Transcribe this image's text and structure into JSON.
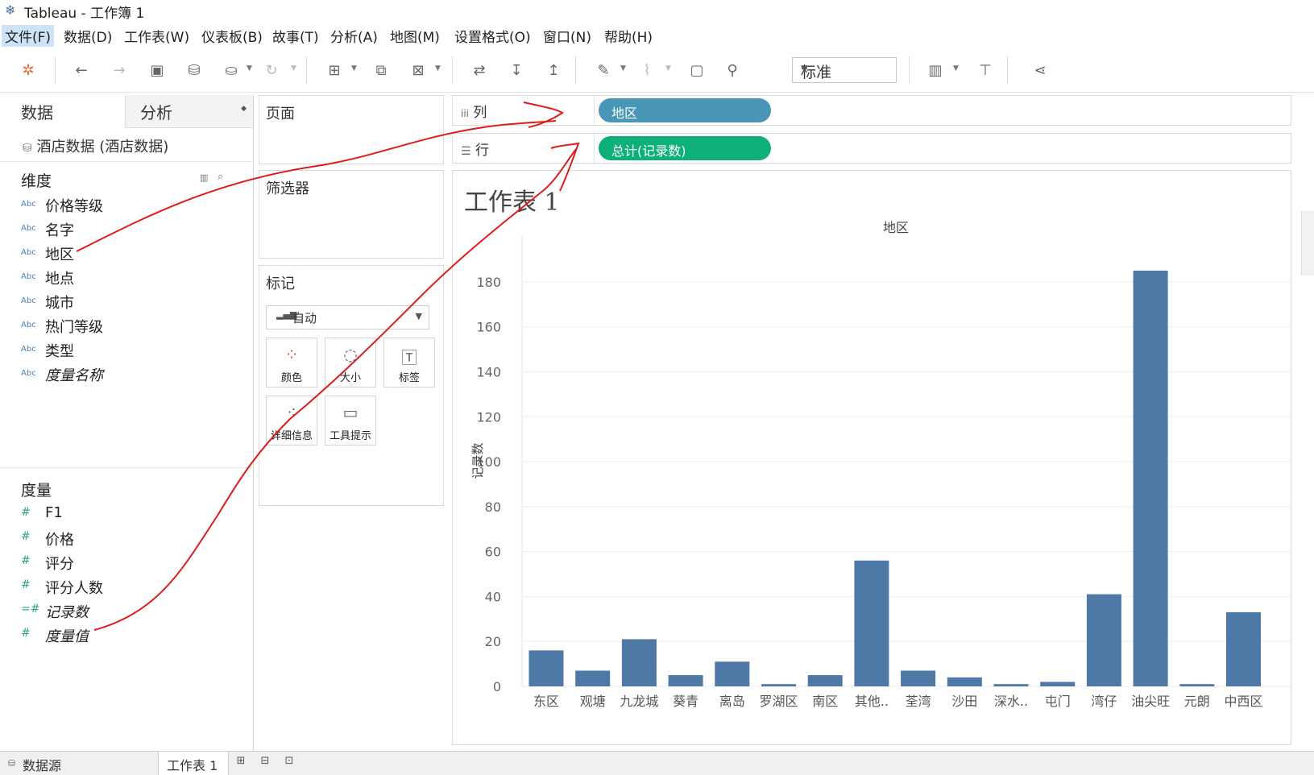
{
  "window": {
    "app_title": "Tableau - 工作簿 1"
  },
  "menu": [
    {
      "label": "文件(F)"
    },
    {
      "label": "数据(D)"
    },
    {
      "label": "工作表(W)"
    },
    {
      "label": "仪表板(B)"
    },
    {
      "label": "故事(T)"
    },
    {
      "label": "分析(A)"
    },
    {
      "label": "地图(M)"
    },
    {
      "label": "设置格式(O)"
    },
    {
      "label": "窗口(N)"
    },
    {
      "label": "帮助(H)"
    }
  ],
  "toolbar": {
    "fit_select": "标准"
  },
  "data_pane": {
    "tab_data": "数据",
    "tab_analysis": "分析",
    "datasource": "酒店数据 (酒店数据)",
    "dimensions_header": "维度",
    "dimensions": [
      {
        "icon": "Abc",
        "label": "价格等级"
      },
      {
        "icon": "Abc",
        "label": "名字"
      },
      {
        "icon": "Abc",
        "label": "地区"
      },
      {
        "icon": "Abc",
        "label": "地点"
      },
      {
        "icon": "Abc",
        "label": "城市"
      },
      {
        "icon": "Abc",
        "label": "热门等级"
      },
      {
        "icon": "Abc",
        "label": "类型"
      },
      {
        "icon": "Abc",
        "label": "度量名称"
      }
    ],
    "measures_header": "度量",
    "measures": [
      {
        "icon": "#",
        "label": "F1"
      },
      {
        "icon": "#",
        "label": "价格"
      },
      {
        "icon": "#",
        "label": "评分"
      },
      {
        "icon": "#",
        "label": "评分人数"
      },
      {
        "icon": "=#",
        "label": "记录数"
      },
      {
        "icon": "#",
        "label": "度量值"
      }
    ]
  },
  "cards": {
    "pages": "页面",
    "filters": "筛选器",
    "marks": "标记",
    "marks_type": "自动",
    "buttons": [
      {
        "label": "颜色"
      },
      {
        "label": "大小"
      },
      {
        "label": "标签"
      },
      {
        "label": "详细信息"
      },
      {
        "label": "工具提示"
      }
    ]
  },
  "shelves": {
    "columns_label": "列",
    "rows_label": "行",
    "columns_pill": "地区",
    "rows_pill": "总计(记录数)",
    "columns_color": "#4a96b7",
    "rows_color": "#0eb07a"
  },
  "sheet": {
    "title": "工作表 1"
  },
  "chart_data": {
    "type": "bar",
    "header": "地区",
    "ylabel": "记录数",
    "ylim": [
      0,
      190
    ],
    "yticks": [
      0,
      20,
      40,
      60,
      80,
      100,
      120,
      140,
      160,
      180
    ],
    "categories": [
      "东区",
      "观塘",
      "九龙城",
      "葵青",
      "离岛",
      "罗湖区",
      "南区",
      "其他..",
      "荃湾",
      "沙田",
      "深水..",
      "屯门",
      "湾仔",
      "油尖旺",
      "元朗",
      "中西区"
    ],
    "values": [
      16,
      7,
      21,
      5,
      11,
      1,
      5,
      56,
      7,
      4,
      1,
      2,
      41,
      185,
      1,
      33
    ],
    "bar_color": "#4e79a7",
    "grid": true
  },
  "bottom_bar": {
    "datasource_tab": "数据源",
    "sheet_tab": "工作表 1"
  }
}
